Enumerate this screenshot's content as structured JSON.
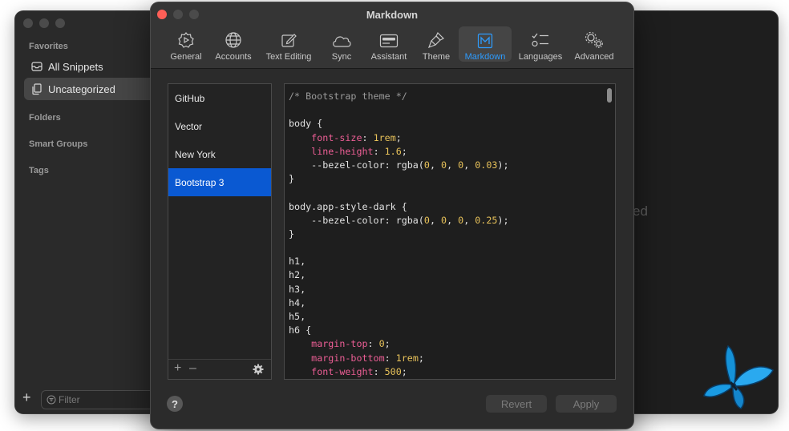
{
  "background_window": {
    "sidebar": {
      "favorites_heading": "Favorites",
      "items": [
        {
          "label": "All Snippets",
          "icon": "tray-icon"
        },
        {
          "label": "Uncategorized",
          "icon": "documents-icon"
        }
      ],
      "folders_heading": "Folders",
      "smart_groups_heading": "Smart Groups",
      "tags_heading": "Tags",
      "filter_placeholder": "Filter"
    },
    "empty_text_fragment": "ed"
  },
  "dialog": {
    "title": "Markdown",
    "toolbar": [
      {
        "label": "General",
        "icon": "gear-dial-icon"
      },
      {
        "label": "Accounts",
        "icon": "globe-icon"
      },
      {
        "label": "Text Editing",
        "icon": "edit-icon"
      },
      {
        "label": "Sync",
        "icon": "cloud-icon"
      },
      {
        "label": "Assistant",
        "icon": "assistant-icon"
      },
      {
        "label": "Theme",
        "icon": "brush-icon"
      },
      {
        "label": "Markdown",
        "icon": "markdown-icon",
        "selected": true
      },
      {
        "label": "Languages",
        "icon": "list-icon"
      },
      {
        "label": "Advanced",
        "icon": "gears-icon"
      }
    ],
    "styles": [
      "GitHub",
      "Vector",
      "New York",
      "Bootstrap 3"
    ],
    "selected_style": "Bootstrap 3",
    "code_lines": [
      [
        {
          "t": "/* Bootstrap theme */",
          "c": "comment"
        }
      ],
      [],
      [
        {
          "t": "body {",
          "c": "plain"
        }
      ],
      [
        {
          "t": "    ",
          "c": "plain"
        },
        {
          "t": "font-size",
          "c": "prop"
        },
        {
          "t": ": ",
          "c": "plain"
        },
        {
          "t": "1rem",
          "c": "num"
        },
        {
          "t": ";",
          "c": "plain"
        }
      ],
      [
        {
          "t": "    ",
          "c": "plain"
        },
        {
          "t": "line-height",
          "c": "prop"
        },
        {
          "t": ": ",
          "c": "plain"
        },
        {
          "t": "1.6",
          "c": "num"
        },
        {
          "t": ";",
          "c": "plain"
        }
      ],
      [
        {
          "t": "    --bezel-color: rgba(",
          "c": "plain"
        },
        {
          "t": "0",
          "c": "num"
        },
        {
          "t": ", ",
          "c": "plain"
        },
        {
          "t": "0",
          "c": "num"
        },
        {
          "t": ", ",
          "c": "plain"
        },
        {
          "t": "0",
          "c": "num"
        },
        {
          "t": ", ",
          "c": "plain"
        },
        {
          "t": "0.03",
          "c": "num"
        },
        {
          "t": ");",
          "c": "plain"
        }
      ],
      [
        {
          "t": "}",
          "c": "plain"
        }
      ],
      [],
      [
        {
          "t": "body.app-style-dark {",
          "c": "plain"
        }
      ],
      [
        {
          "t": "    --bezel-color: rgba(",
          "c": "plain"
        },
        {
          "t": "0",
          "c": "num"
        },
        {
          "t": ", ",
          "c": "plain"
        },
        {
          "t": "0",
          "c": "num"
        },
        {
          "t": ", ",
          "c": "plain"
        },
        {
          "t": "0",
          "c": "num"
        },
        {
          "t": ", ",
          "c": "plain"
        },
        {
          "t": "0.25",
          "c": "num"
        },
        {
          "t": ");",
          "c": "plain"
        }
      ],
      [
        {
          "t": "}",
          "c": "plain"
        }
      ],
      [],
      [
        {
          "t": "h1,",
          "c": "plain"
        }
      ],
      [
        {
          "t": "h2,",
          "c": "plain"
        }
      ],
      [
        {
          "t": "h3,",
          "c": "plain"
        }
      ],
      [
        {
          "t": "h4,",
          "c": "plain"
        }
      ],
      [
        {
          "t": "h5,",
          "c": "plain"
        }
      ],
      [
        {
          "t": "h6 {",
          "c": "plain"
        }
      ],
      [
        {
          "t": "    ",
          "c": "plain"
        },
        {
          "t": "margin-top",
          "c": "prop"
        },
        {
          "t": ": ",
          "c": "plain"
        },
        {
          "t": "0",
          "c": "num"
        },
        {
          "t": ";",
          "c": "plain"
        }
      ],
      [
        {
          "t": "    ",
          "c": "plain"
        },
        {
          "t": "margin-bottom",
          "c": "prop"
        },
        {
          "t": ": ",
          "c": "plain"
        },
        {
          "t": "1rem",
          "c": "num"
        },
        {
          "t": ";",
          "c": "plain"
        }
      ],
      [
        {
          "t": "    ",
          "c": "plain"
        },
        {
          "t": "font-weight",
          "c": "prop"
        },
        {
          "t": ": ",
          "c": "plain"
        },
        {
          "t": "500",
          "c": "num"
        },
        {
          "t": ";",
          "c": "plain"
        }
      ]
    ],
    "footer": {
      "help_label": "?",
      "revert_label": "Revert",
      "apply_label": "Apply"
    }
  },
  "colors": {
    "accent": "#2d9cff",
    "selection": "#0a59d2",
    "close_button": "#fe5f57",
    "syntax_property": "#ec5e95",
    "syntax_number": "#e8c25a",
    "butterfly": "#1a9be3"
  }
}
